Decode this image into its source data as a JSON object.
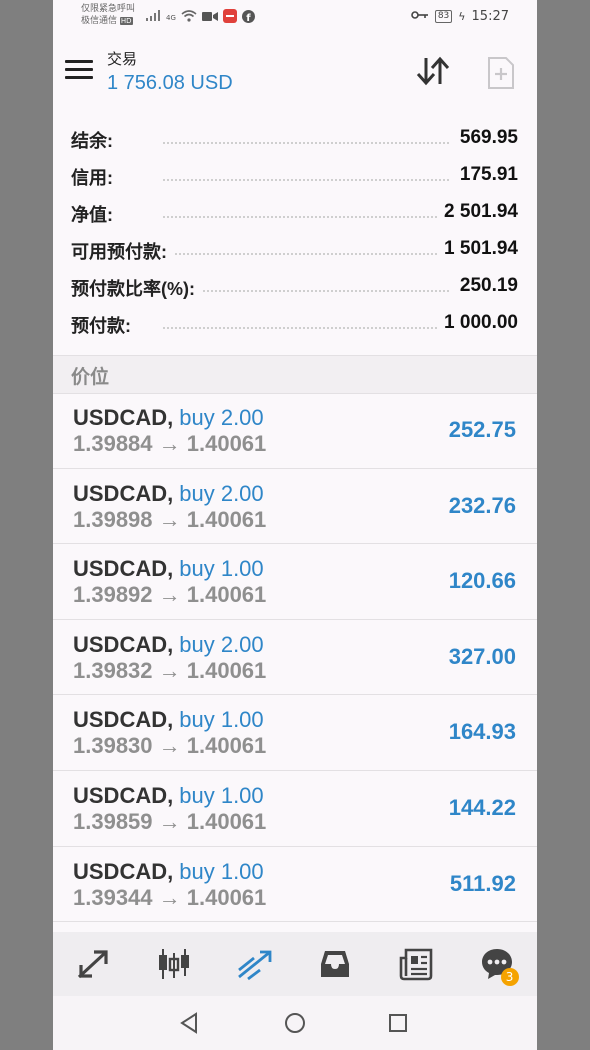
{
  "status_bar": {
    "carrier_line1": "仅限紧急呼叫",
    "carrier_line2": "极信通信",
    "hd": "HD",
    "network": "4G",
    "battery": "83",
    "time": "15:27"
  },
  "app_bar": {
    "title": "交易",
    "balance": "1 756.08 USD"
  },
  "summary": [
    {
      "label": "结余:",
      "value": "569.95"
    },
    {
      "label": "信用:",
      "value": "175.91"
    },
    {
      "label": "净值:",
      "value": "2 501.94"
    },
    {
      "label": "可用预付款:",
      "value": "1 501.94"
    },
    {
      "label": "预付款比率(%):",
      "value": "250.19"
    },
    {
      "label": "预付款:",
      "value": "1 000.00"
    }
  ],
  "section": {
    "title": "价位"
  },
  "positions": [
    {
      "symbol": "USDCAD",
      "comma": ",",
      "type": "buy 2.00",
      "prices": "1.39884 → 1.40061",
      "profit": "252.75"
    },
    {
      "symbol": "USDCAD",
      "comma": ",",
      "type": "buy 2.00",
      "prices": "1.39898 → 1.40061",
      "profit": "232.76"
    },
    {
      "symbol": "USDCAD",
      "comma": ",",
      "type": "buy 1.00",
      "prices": "1.39892 → 1.40061",
      "profit": "120.66"
    },
    {
      "symbol": "USDCAD",
      "comma": ",",
      "type": "buy 2.00",
      "prices": "1.39832 → 1.40061",
      "profit": "327.00"
    },
    {
      "symbol": "USDCAD",
      "comma": ",",
      "type": "buy 1.00",
      "prices": "1.39830 → 1.40061",
      "profit": "164.93"
    },
    {
      "symbol": "USDCAD",
      "comma": ",",
      "type": "buy 1.00",
      "prices": "1.39859 → 1.40061",
      "profit": "144.22"
    },
    {
      "symbol": "USDCAD",
      "comma": ",",
      "type": "buy 1.00",
      "prices": "1.39344 → 1.40061",
      "profit": "511.92"
    }
  ],
  "bottom_nav": {
    "items": [
      {
        "icon": "quotes-arrows-icon",
        "active": false
      },
      {
        "icon": "candlestick-chart-icon",
        "active": false
      },
      {
        "icon": "trade-chart-icon",
        "active": true
      },
      {
        "icon": "inbox-icon",
        "active": false
      },
      {
        "icon": "news-icon",
        "active": false
      },
      {
        "icon": "chat-icon",
        "active": false,
        "badge": "3"
      }
    ]
  },
  "colors": {
    "accent": "#2f86c8",
    "badge": "#f5a300",
    "background": "#fbf8fb",
    "outside": "#7f7f7f"
  }
}
